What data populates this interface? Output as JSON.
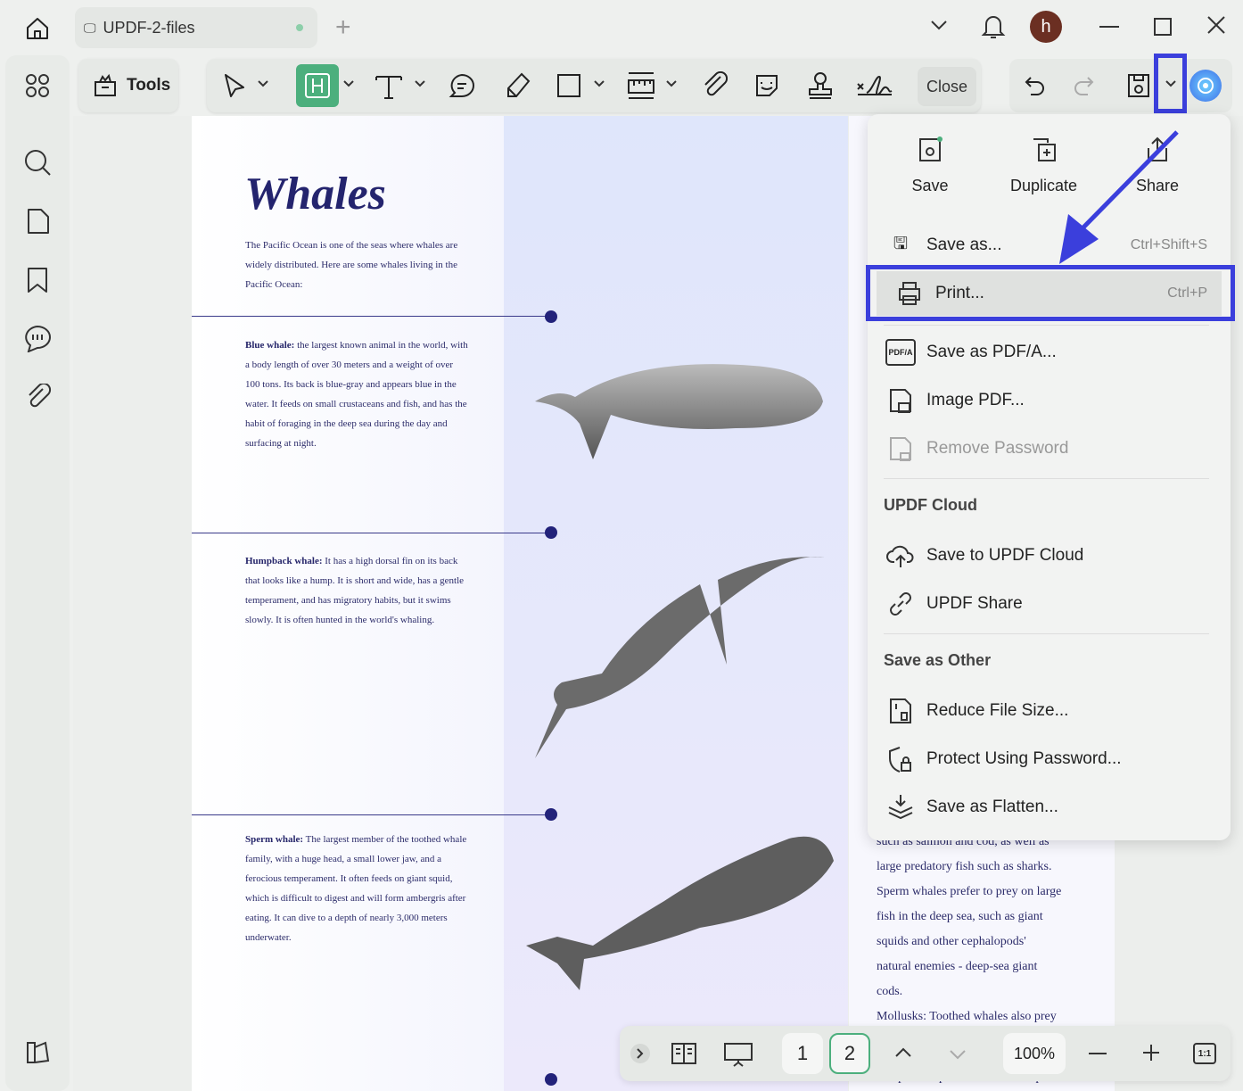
{
  "tab": {
    "title": "UPDF-2-files"
  },
  "user": {
    "avatar_letter": "h"
  },
  "toolbar": {
    "tools_label": "Tools",
    "close_label": "Close"
  },
  "document": {
    "title": "Whales",
    "intro": "The Pacific Ocean is one of the seas where whales are widely distributed. Here are some whales living in the Pacific Ocean:",
    "sections": [
      {
        "name": "Blue whale:",
        "text": " the largest known animal in the world, with a body length of over 30 meters and a weight of over 100 tons. Its back is blue-gray and appears blue in the water. It feeds on small crustaceans and fish, and has the habit of foraging in the deep sea during the day and surfacing at night."
      },
      {
        "name": "Humpback whale:",
        "text": " It has a high dorsal fin on its back that looks like a hump. It is short and wide, has a gentle temperament, and has migratory habits, but it swims slowly. It is often hunted in the world's whaling."
      },
      {
        "name": "Sperm whale:",
        "text": " The largest member of the toothed whale family, with a huge head, a small lower jaw, and a ferocious temperament. It often feeds on giant squid, which is difficult to digest and will form ambergris after eating. It can dive to a depth of nearly 3,000 meters underwater."
      }
    ],
    "page2_lines": [
      "such as salmon and cod, as well as",
      "large predatory fish such as sharks.",
      "Sperm whales prefer to prey on large",
      "fish in the deep sea, such as giant",
      "squids and other cephalopods'",
      "natural enemies - deep-sea giant",
      "cods.",
      "Mollusks: Toothed whales also prey",
      "octopuses. Sperm whales are experts"
    ]
  },
  "menu": {
    "top": [
      {
        "label": "Save"
      },
      {
        "label": "Duplicate"
      },
      {
        "label": "Share"
      }
    ],
    "save_as": {
      "label": "Save as...",
      "shortcut": "Ctrl+Shift+S"
    },
    "print": {
      "label": "Print...",
      "shortcut": "Ctrl+P"
    },
    "pdfa": {
      "label": "Save as PDF/A..."
    },
    "image_pdf": {
      "label": "Image PDF..."
    },
    "remove_password": {
      "label": "Remove Password"
    },
    "cloud_header": "UPDF Cloud",
    "save_cloud": {
      "label": "Save to UPDF Cloud"
    },
    "updf_share": {
      "label": "UPDF Share"
    },
    "other_header": "Save as Other",
    "reduce": {
      "label": "Reduce File Size..."
    },
    "protect": {
      "label": "Protect Using Password..."
    },
    "flatten": {
      "label": "Save as Flatten..."
    }
  },
  "bottom": {
    "page1": "1",
    "page2": "2",
    "zoom": "100%",
    "actual_size": "1:1"
  },
  "colors": {
    "accent_green": "#4caf7d",
    "highlight_blue": "#3b3fdc"
  }
}
